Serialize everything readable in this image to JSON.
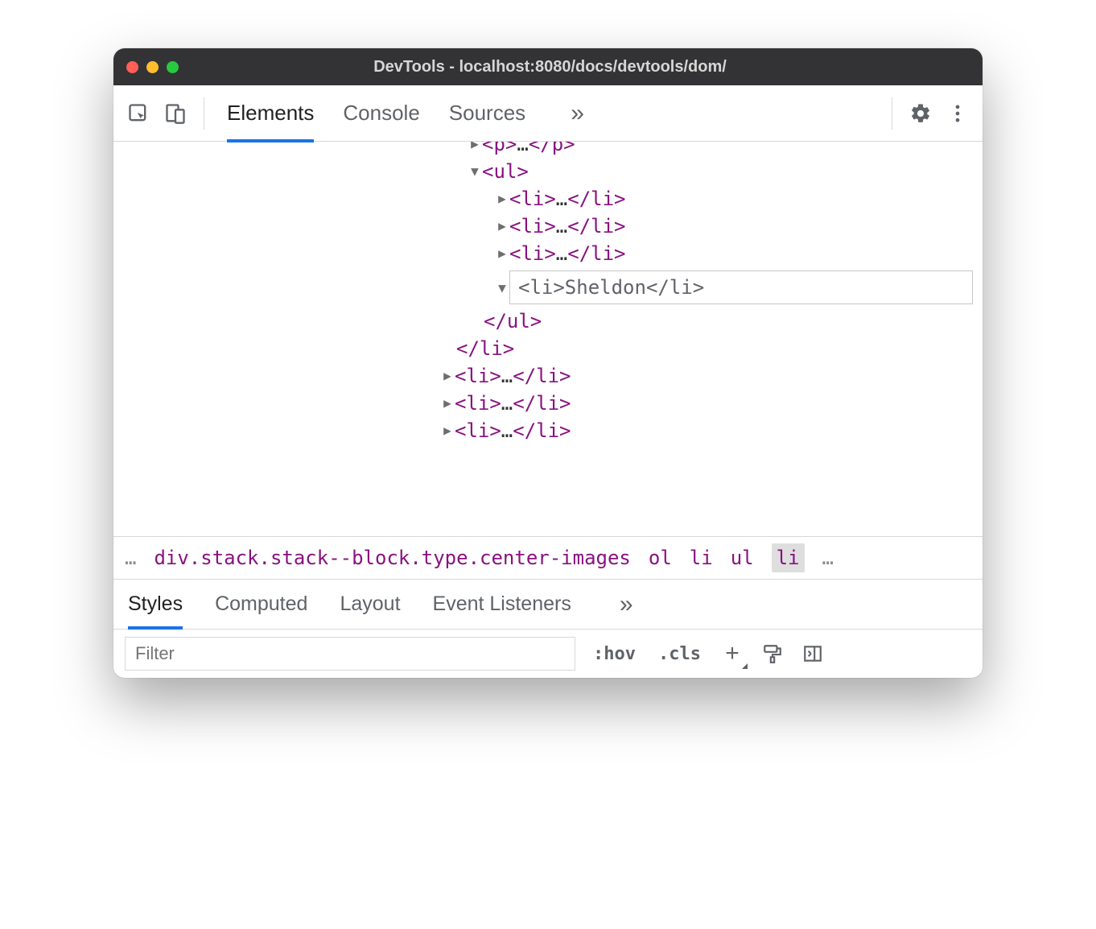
{
  "window": {
    "title": "DevTools - localhost:8080/docs/devtools/dom/"
  },
  "toolbar": {
    "tabs": [
      "Elements",
      "Console",
      "Sources"
    ],
    "active_tab": "Elements"
  },
  "dom": {
    "p_open": "<p>",
    "p_ellipsis": "…",
    "p_close": "</p>",
    "ul_open": "<ul>",
    "ul_close": "</ul>",
    "li_items_top": [
      {
        "open": "<li>",
        "ellipsis": "…",
        "close": "</li>"
      },
      {
        "open": "<li>",
        "ellipsis": "…",
        "close": "</li>"
      },
      {
        "open": "<li>",
        "ellipsis": "…",
        "close": "</li>"
      }
    ],
    "edit_value": "<li>Sheldon</li>",
    "li_close": "</li>",
    "li_items_bottom": [
      {
        "open": "<li>",
        "ellipsis": "…",
        "close": "</li>"
      },
      {
        "open": "<li>",
        "ellipsis": "…",
        "close": "</li>"
      },
      {
        "open": "<li>",
        "ellipsis": "…",
        "close": "</li>"
      }
    ]
  },
  "breadcrumbs": {
    "prefix": "…",
    "path": [
      "div.stack.stack--block.type.center-images",
      "ol",
      "li",
      "ul",
      "li"
    ],
    "suffix": "…",
    "selected_index": 4
  },
  "subtabs": {
    "items": [
      "Styles",
      "Computed",
      "Layout",
      "Event Listeners"
    ],
    "active": "Styles"
  },
  "styles_toolbar": {
    "filter_placeholder": "Filter",
    "hov": ":hov",
    "cls": ".cls",
    "plus": "+"
  }
}
